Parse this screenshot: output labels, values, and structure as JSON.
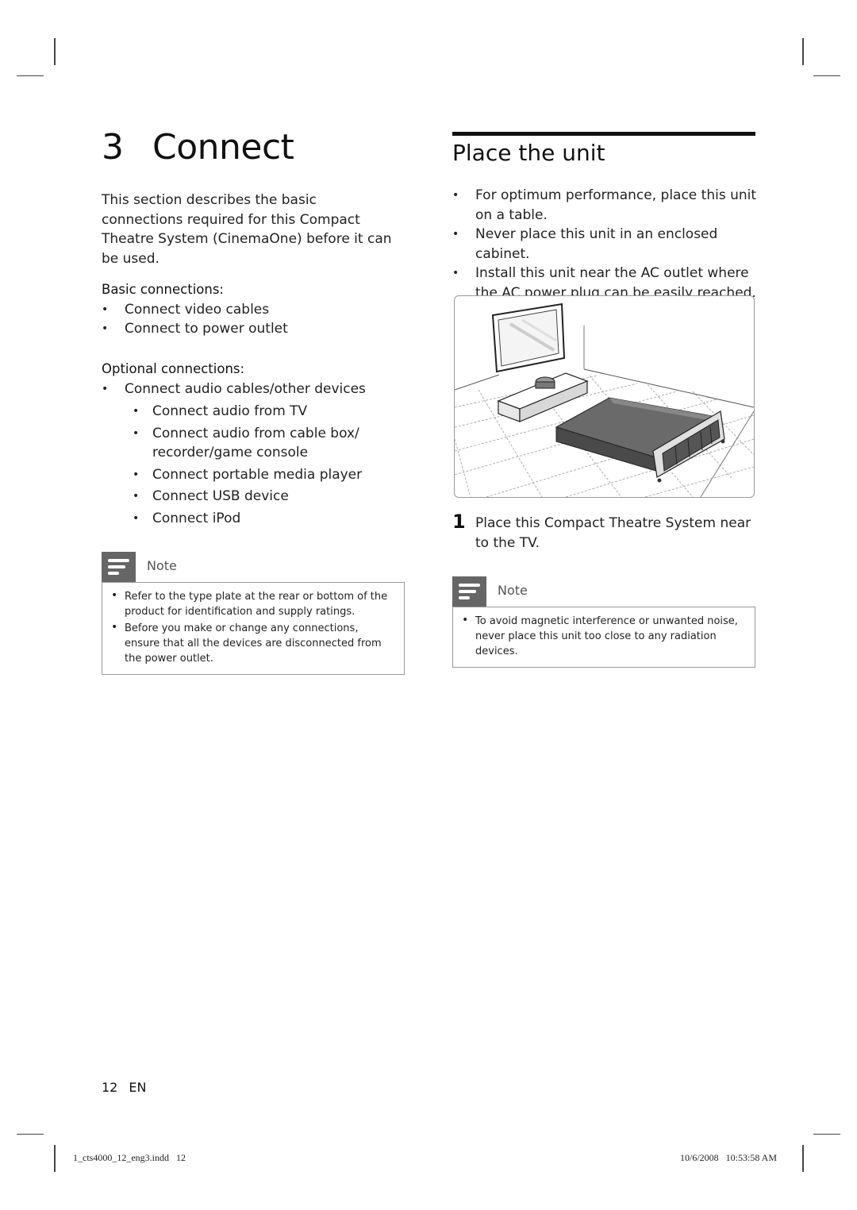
{
  "left": {
    "chapter_number": "3",
    "chapter_title": "Connect",
    "intro": "This section describes the basic connections required for this Compact Theatre System (CinemaOne) before it can be used.",
    "basic_heading": "Basic connections:",
    "basic_items": [
      "Connect video cables",
      "Connect to power outlet"
    ],
    "optional_heading": "Optional connections:",
    "optional_items": [
      "Connect audio cables/other devices"
    ],
    "optional_subitems": [
      "Connect audio from TV",
      "Connect audio from cable box/ recorder/game console",
      "Connect portable media player",
      "Connect USB device",
      "Connect iPod"
    ],
    "note": {
      "label": "Note",
      "icon": "note-icon",
      "items": [
        "Refer to the type plate at the rear or bottom of the product for identification and supply ratings.",
        "Before you make or change any connections, ensure that all the devices are disconnected from the power outlet."
      ]
    }
  },
  "right": {
    "section_title": "Place the unit",
    "items": [
      "For optimum performance, place this unit on a table.",
      "Never place this unit in an enclosed cabinet.",
      "Install this unit near the AC outlet where the AC power plug can be easily reached."
    ],
    "illustration": "Room illustration: wall-mounted TV, compact theatre unit on low table, and bed in tiled room",
    "step": {
      "number": "1",
      "text": "Place this Compact Theatre System near to the TV."
    },
    "note": {
      "label": "Note",
      "icon": "note-icon",
      "items": [
        "To avoid magnetic interference or unwanted noise, never place this unit too close to any radiation devices."
      ]
    }
  },
  "footer": {
    "page_number": "12",
    "language": "EN",
    "slug_file": "1_cts4000_12_eng3.indd   12",
    "slug_timestamp": "10/6/2008   10:53:58 AM"
  }
}
